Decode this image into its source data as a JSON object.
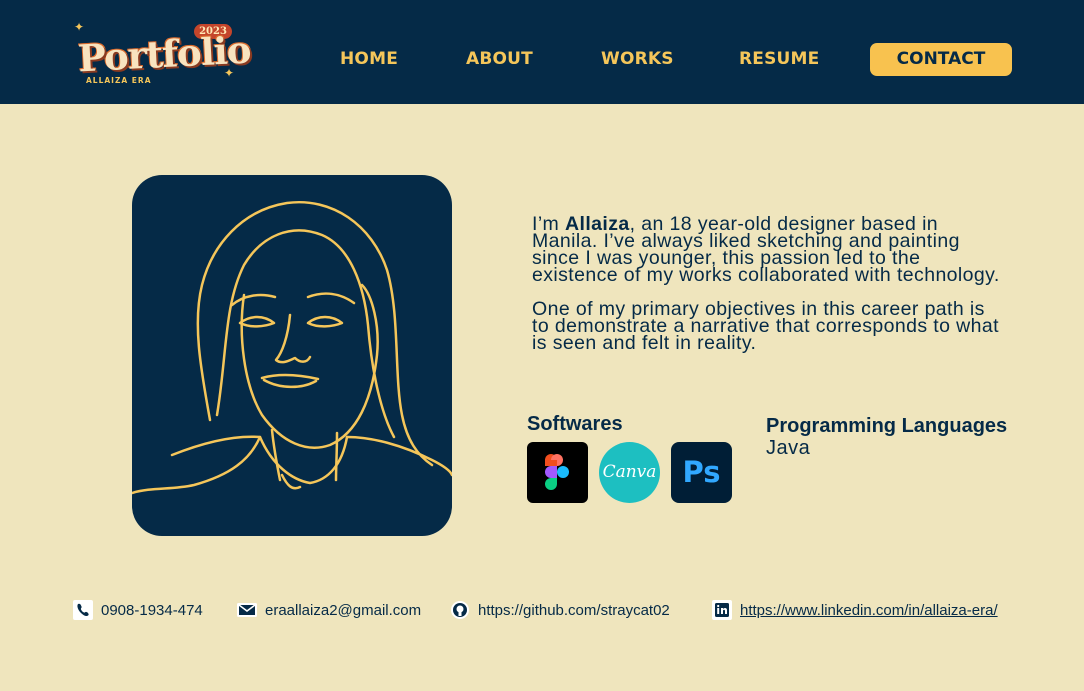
{
  "header": {
    "logo": {
      "year": "2023",
      "word": "Portfolio",
      "sub": "ALLAIZA ERA"
    },
    "nav": [
      {
        "label": "HOME"
      },
      {
        "label": "ABOUT"
      },
      {
        "label": "WORKS"
      },
      {
        "label": "RESUME"
      },
      {
        "label": "CONTACT"
      }
    ]
  },
  "about": {
    "intro_prefix": "I’m ",
    "name": "Allaiza",
    "intro_rest": ", an 18 year-old designer based in Manila. I’ve always liked sketching and painting since I was younger, this passion led to the existence of my works collaborated with technology.",
    "paragraph2": "One of my primary objectives in this career path is to demonstrate a narrative that corresponds to what is seen and felt in reality."
  },
  "skills": {
    "softwares_title": "Softwares",
    "softwares": [
      {
        "name": "Figma",
        "icon": "figma-icon"
      },
      {
        "name": "Canva",
        "icon": "canva-icon"
      },
      {
        "name": "Ps",
        "icon": "photoshop-icon"
      }
    ],
    "languages_title": "Programming Languages",
    "languages": "Java"
  },
  "contacts": {
    "phone": "0908-1934-474",
    "email": "eraallaiza2@gmail.com",
    "github": "https://github.com/straycat02",
    "linkedin": "https://www.linkedin.com/in/allaiza-era/"
  },
  "colors": {
    "navy": "#052a47",
    "cream": "#efe5bd",
    "gold": "#f5c65a",
    "button": "#f8c24f"
  }
}
